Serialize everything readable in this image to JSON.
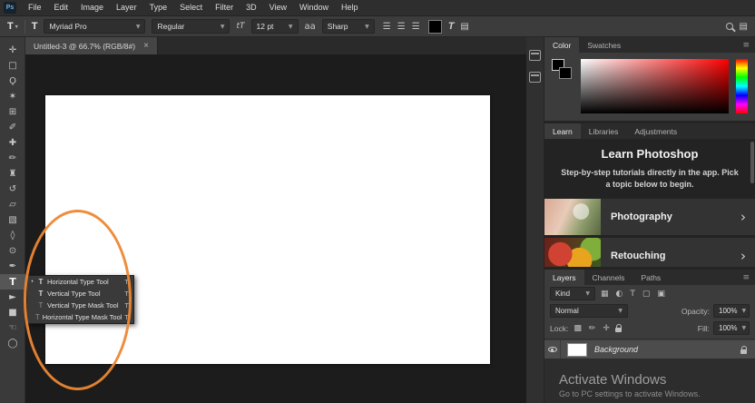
{
  "menubar": {
    "logo": "Ps",
    "items": [
      "File",
      "Edit",
      "Image",
      "Layer",
      "Type",
      "Select",
      "Filter",
      "3D",
      "View",
      "Window",
      "Help"
    ]
  },
  "options": {
    "tool_icon": "T",
    "preset_arrow": "▾",
    "orientation_icon": "T",
    "font_family": "Myriad Pro",
    "font_style": "Regular",
    "size_icon": "tT",
    "font_size": "12 pt",
    "aa_icon": "aa",
    "anti_alias": "Sharp",
    "align_left_icon": "☰",
    "align_center_icon": "☰",
    "align_right_icon": "☰",
    "warp_icon": "T",
    "panels_icon": "▤",
    "workspace_icon": "▤",
    "combo_arrow": "▼"
  },
  "document": {
    "tab_title": "Untitled-3 @ 66.7% (RGB/8#)",
    "close_icon": "×"
  },
  "tools": [
    {
      "name": "move-tool",
      "glyph": "✛"
    },
    {
      "name": "marquee-tool",
      "glyph": "□"
    },
    {
      "name": "lasso-tool",
      "glyph": "Ϙ"
    },
    {
      "name": "quick-selection-tool",
      "glyph": "✶"
    },
    {
      "name": "crop-tool",
      "glyph": "⊞"
    },
    {
      "name": "eyedropper-tool",
      "glyph": "✐"
    },
    {
      "name": "healing-brush-tool",
      "glyph": "✚"
    },
    {
      "name": "brush-tool",
      "glyph": "✏"
    },
    {
      "name": "clone-stamp-tool",
      "glyph": "♜"
    },
    {
      "name": "history-brush-tool",
      "glyph": "↺"
    },
    {
      "name": "eraser-tool",
      "glyph": "▱"
    },
    {
      "name": "gradient-tool",
      "glyph": "▧"
    },
    {
      "name": "blur-tool",
      "glyph": "◊"
    },
    {
      "name": "dodge-tool",
      "glyph": "⊙"
    },
    {
      "name": "pen-tool",
      "glyph": "✒"
    },
    {
      "name": "type-tool",
      "glyph": "T"
    },
    {
      "name": "path-selection-tool",
      "glyph": "►"
    },
    {
      "name": "shape-tool",
      "glyph": "■"
    },
    {
      "name": "hand-tool",
      "glyph": "☜"
    },
    {
      "name": "zoom-tool",
      "glyph": "◯"
    }
  ],
  "flyout": {
    "items": [
      {
        "bullet": "•",
        "icon": "T",
        "label": "Horizontal Type Tool",
        "shortcut": "T"
      },
      {
        "icon": "T",
        "label": "Vertical Type Tool",
        "shortcut": "T"
      },
      {
        "icon": "T",
        "label": "Vertical Type Mask Tool",
        "shortcut": "T"
      },
      {
        "icon": "T",
        "label": "Horizontal Type Mask Tool",
        "shortcut": "T"
      }
    ]
  },
  "panels": {
    "color": {
      "tabs": [
        "Color",
        "Swatches"
      ],
      "menu_icon": "≡"
    },
    "learn": {
      "tabs": [
        "Learn",
        "Libraries",
        "Adjustments"
      ],
      "title": "Learn Photoshop",
      "description": "Step-by-step tutorials directly in the app. Pick a topic below to begin.",
      "topics": [
        {
          "label": "Photography"
        },
        {
          "label": "Retouching"
        }
      ],
      "chevron": "›"
    },
    "layers": {
      "tabs": [
        "Layers",
        "Channels",
        "Paths"
      ],
      "menu_icon": "≡",
      "kind_label": "Kind",
      "filter_icons": [
        "▦",
        "◐",
        "T",
        "▢",
        "▣"
      ],
      "blend_mode": "Normal",
      "opacity_label": "Opacity:",
      "opacity_value": "100%",
      "lock_label": "Lock:",
      "lock_icons": [
        "▩",
        "✏",
        "✛"
      ],
      "fill_label": "Fill:",
      "fill_value": "100%",
      "layer_name": "Background"
    }
  },
  "watermark": {
    "title": "Activate Windows",
    "subtitle": "Go to PC settings to activate Windows."
  },
  "annotation": {
    "ellipse_color": "#ed8733"
  }
}
